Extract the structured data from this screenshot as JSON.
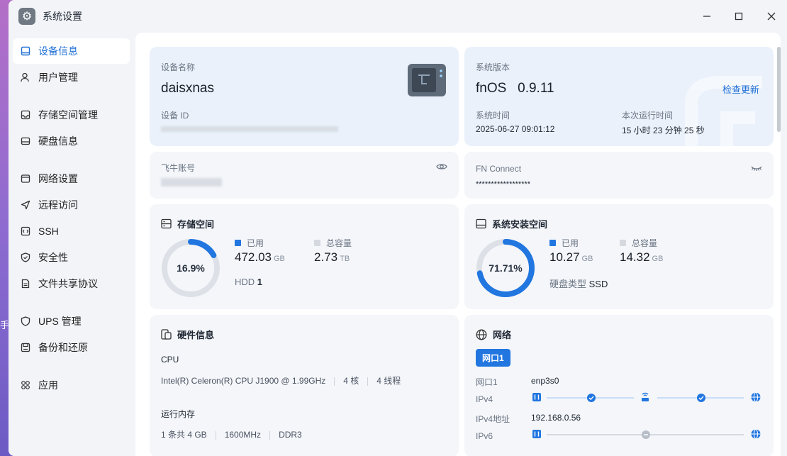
{
  "desktop": {
    "fragment": "手"
  },
  "window": {
    "title": "系统设置"
  },
  "sidebar": {
    "items": [
      {
        "label": "设备信息",
        "icon": "monitor-icon"
      },
      {
        "label": "用户管理",
        "icon": "user-icon"
      },
      {
        "label": "存储空间管理",
        "icon": "storage-icon"
      },
      {
        "label": "硬盘信息",
        "icon": "hard-disk-icon"
      },
      {
        "label": "网络设置",
        "icon": "network-icon"
      },
      {
        "label": "远程访问",
        "icon": "send-icon"
      },
      {
        "label": "SSH",
        "icon": "code-icon"
      },
      {
        "label": "安全性",
        "icon": "shield-icon"
      },
      {
        "label": "文件共享协议",
        "icon": "file-icon"
      },
      {
        "label": "UPS 管理",
        "icon": "ups-shield-icon"
      },
      {
        "label": "备份和还原",
        "icon": "backup-icon"
      },
      {
        "label": "应用",
        "icon": "apps-icon"
      }
    ]
  },
  "device": {
    "name_label": "设备名称",
    "name": "daisxnas",
    "id_label": "设备 ID"
  },
  "system": {
    "version_label": "系统版本",
    "version": "fnOS   0.9.11",
    "check_update": "检查更新",
    "time_label": "系统时间",
    "time": "2025-06-27 09:01:12",
    "uptime_label": "本次运行时间",
    "uptime": "15 小时 23 分钟 25 秒"
  },
  "account": {
    "label": "飞牛账号"
  },
  "fnconnect": {
    "label": "FN Connect",
    "value": "******************"
  },
  "storage": {
    "title": "存储空间",
    "percent": "16.9%",
    "percent_value": 16.9,
    "used_label": "已用",
    "used_value": "472.03",
    "used_unit": "GB",
    "total_label": "总容量",
    "total_value": "2.73",
    "total_unit": "TB",
    "hdd_label": "HDD",
    "hdd_count": "1",
    "color": "#2176e0"
  },
  "sysdisk": {
    "title": "系统安装空间",
    "percent": "71.71%",
    "percent_value": 71.71,
    "used_label": "已用",
    "used_value": "10.27",
    "used_unit": "GB",
    "total_label": "总容量",
    "total_value": "14.32",
    "total_unit": "GB",
    "type_label": "硬盘类型",
    "type_value": "SSD"
  },
  "hardware": {
    "title": "硬件信息",
    "cpu_label": "CPU",
    "cpu_model": "Intel(R) Celeron(R) CPU J1900 @ 1.99GHz",
    "cpu_cores": "4 核",
    "cpu_threads": "4 线程",
    "mem_label": "运行内存",
    "mem_slots": "1 条共 4 GB",
    "mem_freq": "1600MHz",
    "mem_type": "DDR3"
  },
  "network": {
    "title": "网络",
    "tab": "网口1",
    "port_label": "网口1",
    "port_value": "enp3s0",
    "ipv4_label": "IPv4",
    "ipv4_addr_label": "IPv4地址",
    "ipv4_addr": "192.168.0.56",
    "ipv6_label": "IPv6"
  }
}
